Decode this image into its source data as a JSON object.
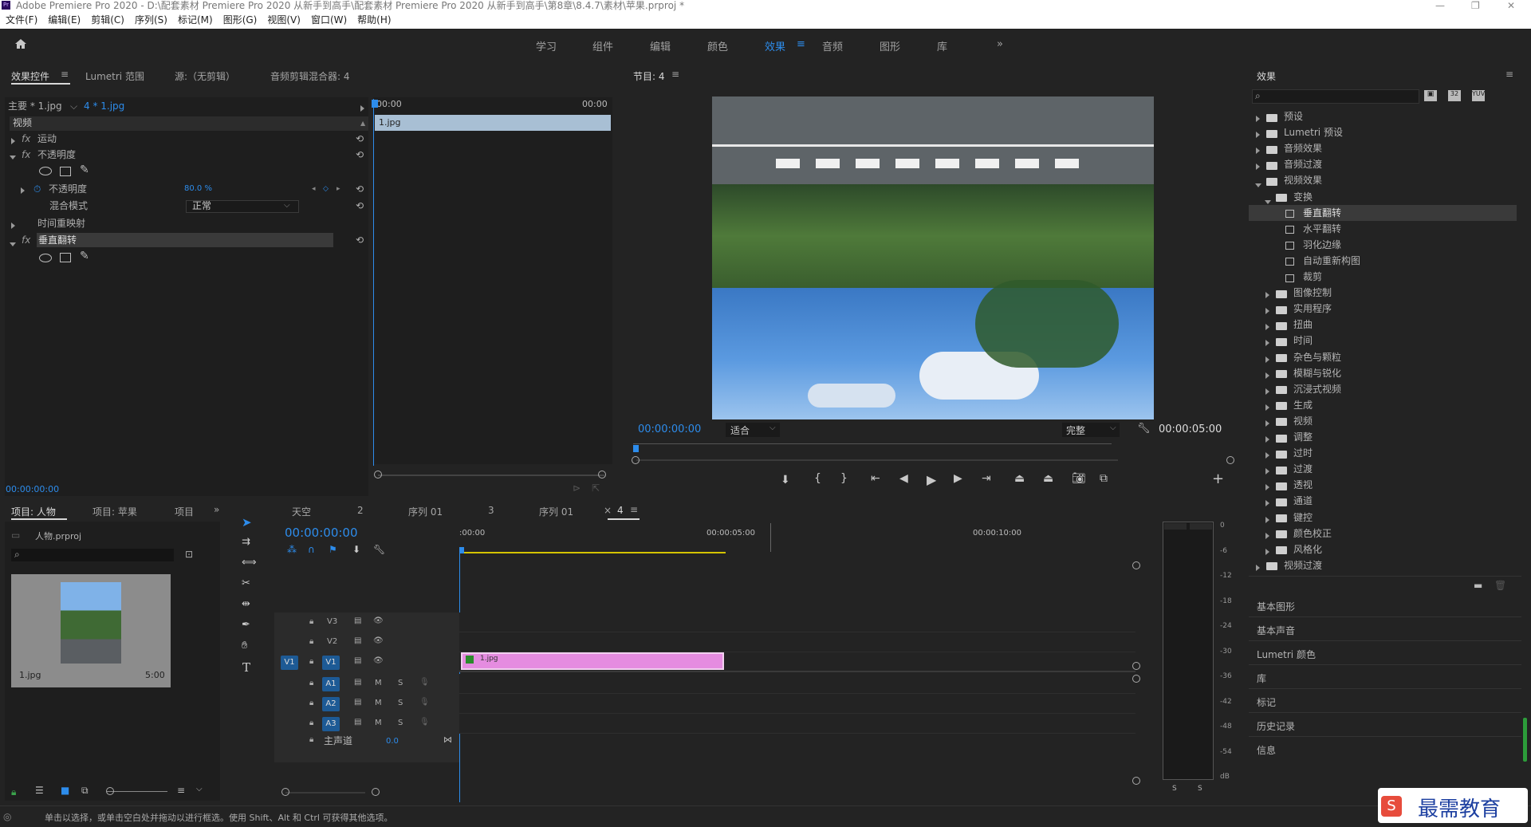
{
  "window": {
    "title": "Adobe Premiere Pro 2020 - D:\\配套素材 Premiere Pro 2020 从新手到高手\\配套素材 Premiere Pro 2020 从新手到高手\\第8章\\8.4.7\\素材\\苹果.prproj *"
  },
  "menu": [
    "文件(F)",
    "编辑(E)",
    "剪辑(C)",
    "序列(S)",
    "标记(M)",
    "图形(G)",
    "视图(V)",
    "窗口(W)",
    "帮助(H)"
  ],
  "workspaces": {
    "items": [
      "学习",
      "组件",
      "编辑",
      "颜色",
      "效果",
      "音频",
      "图形",
      "库"
    ],
    "active": "效果",
    "more": "»"
  },
  "effect_controls": {
    "tabs": [
      "效果控件",
      "Lumetri 范围",
      "源:（无剪辑）",
      "音频剪辑混合器: 4"
    ],
    "master": "主要 * 1.jpg",
    "clip": "4 * 1.jpg",
    "time_start": "00:00",
    "time_end": "00:00",
    "clip_label": "1.jpg",
    "video_header": "视频",
    "motion": "运动",
    "opacity": "不透明度",
    "opacity_param": "不透明度",
    "opacity_value": "80.0 %",
    "blend_label": "混合模式",
    "blend_value": "正常",
    "time_remap": "时间重映射",
    "vflip": "垂直翻转",
    "timecode": "00:00:00:00"
  },
  "program": {
    "title": "节目: 4",
    "timecode": "00:00:00:00",
    "fit": "适合",
    "quality": "完整",
    "duration": "00:00:05:00"
  },
  "effects": {
    "title": "效果",
    "tree": [
      {
        "label": "预设",
        "level": 0,
        "type": "bin",
        "open": false
      },
      {
        "label": "Lumetri 预设",
        "level": 0,
        "type": "bin",
        "open": false
      },
      {
        "label": "音频效果",
        "level": 0,
        "type": "folder",
        "open": false
      },
      {
        "label": "音频过渡",
        "level": 0,
        "type": "folder",
        "open": false
      },
      {
        "label": "视频效果",
        "level": 0,
        "type": "folder",
        "open": true
      },
      {
        "label": "变换",
        "level": 1,
        "type": "folder",
        "open": true
      },
      {
        "label": "垂直翻转",
        "level": 2,
        "type": "fx",
        "selected": true
      },
      {
        "label": "水平翻转",
        "level": 2,
        "type": "fx"
      },
      {
        "label": "羽化边缘",
        "level": 2,
        "type": "fx"
      },
      {
        "label": "自动重新构图",
        "level": 2,
        "type": "fx"
      },
      {
        "label": "裁剪",
        "level": 2,
        "type": "fx"
      },
      {
        "label": "图像控制",
        "level": 1,
        "type": "folder"
      },
      {
        "label": "实用程序",
        "level": 1,
        "type": "folder"
      },
      {
        "label": "扭曲",
        "level": 1,
        "type": "folder"
      },
      {
        "label": "时间",
        "level": 1,
        "type": "folder"
      },
      {
        "label": "杂色与颗粒",
        "level": 1,
        "type": "folder"
      },
      {
        "label": "模糊与锐化",
        "level": 1,
        "type": "folder"
      },
      {
        "label": "沉浸式视频",
        "level": 1,
        "type": "folder"
      },
      {
        "label": "生成",
        "level": 1,
        "type": "folder"
      },
      {
        "label": "视频",
        "level": 1,
        "type": "folder"
      },
      {
        "label": "调整",
        "level": 1,
        "type": "folder"
      },
      {
        "label": "过时",
        "level": 1,
        "type": "folder"
      },
      {
        "label": "过渡",
        "level": 1,
        "type": "folder"
      },
      {
        "label": "透视",
        "level": 1,
        "type": "folder"
      },
      {
        "label": "通道",
        "level": 1,
        "type": "folder"
      },
      {
        "label": "键控",
        "level": 1,
        "type": "folder"
      },
      {
        "label": "颜色校正",
        "level": 1,
        "type": "folder"
      },
      {
        "label": "风格化",
        "level": 1,
        "type": "folder"
      },
      {
        "label": "视频过渡",
        "level": 0,
        "type": "folder",
        "open": false
      }
    ],
    "collapsed_panels": [
      "基本图形",
      "基本声音",
      "Lumetri 颜色",
      "库",
      "标记",
      "历史记录",
      "信息"
    ]
  },
  "project": {
    "tabs": [
      "项目: 人物",
      "项目: 苹果",
      "项目"
    ],
    "file": "人物.prproj",
    "thumb_name": "1.jpg",
    "thumb_dur": "5:00"
  },
  "timeline": {
    "tabs": [
      "天空",
      "2",
      "序列 01",
      "3",
      "序列 01",
      "4"
    ],
    "timecode": "00:00:00:00",
    "ruler": [
      ":00:00",
      "00:00:05:00",
      "00:00:10:00"
    ],
    "tracks": [
      "V3",
      "V2",
      "V1",
      "A1",
      "A2",
      "A3"
    ],
    "master": "主声道",
    "master_val": "0.0",
    "clip": "1.jpg"
  },
  "meter": {
    "labels": [
      "0",
      "-6",
      "-12",
      "-18",
      "-24",
      "-30",
      "-36",
      "-42",
      "-48",
      "-54",
      "dB"
    ],
    "solo": [
      "S",
      "S"
    ]
  },
  "status": {
    "text": "单击以选择，或单击空白处并拖动以进行框选。使用 Shift、Alt 和 Ctrl 可获得其他选项。"
  },
  "watermark": {
    "text": "最需教育"
  }
}
